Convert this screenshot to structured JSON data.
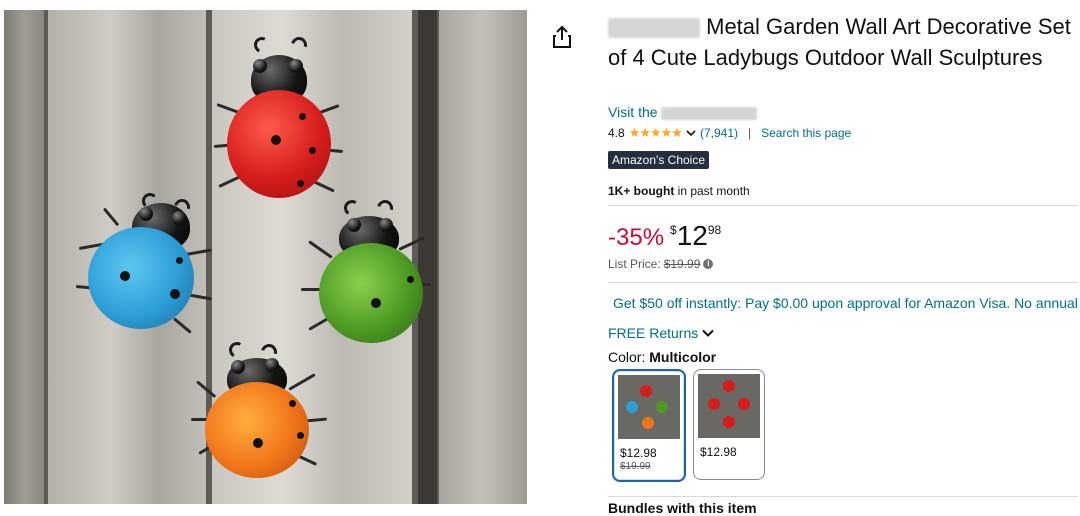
{
  "product": {
    "title": "Metal Garden Wall Art Decorative Set of 4 Cute Ladybugs Outdoor Wall Sculptures",
    "store_prefix": "Visit the",
    "rating_value": "4.8",
    "stars": "★★★★★",
    "rating_count": "(7,941)",
    "rating_separator": "|",
    "search_page": "Search this page",
    "badge": "Amazon's Choice",
    "bought_bold": "1K+ bought",
    "bought_rest": " in past month",
    "discount": "-35%",
    "price_symbol": "$",
    "price_whole": "12",
    "price_fraction": "98",
    "list_price_label": "List Price:",
    "list_price": "$19.99",
    "promo": "Get $50 off instantly: Pay $0.00 upon approval for Amazon Visa. No annual",
    "returns": "FREE Returns",
    "color_label": "Color:",
    "color_value": "Multicolor",
    "bundles": "Bundles with this item"
  },
  "swatches": [
    {
      "price": "$12.98",
      "list_price": "$19.99"
    },
    {
      "price": "$12.98"
    }
  ],
  "icons": {
    "share": "share-icon",
    "chevron": "chevron-down-icon",
    "info": "info-icon"
  },
  "colors": {
    "link": "#007185",
    "discount": "#cc0c39",
    "star": "#ffa41c",
    "badge_bg": "#232f3e",
    "selected_border": "#2162a1"
  }
}
